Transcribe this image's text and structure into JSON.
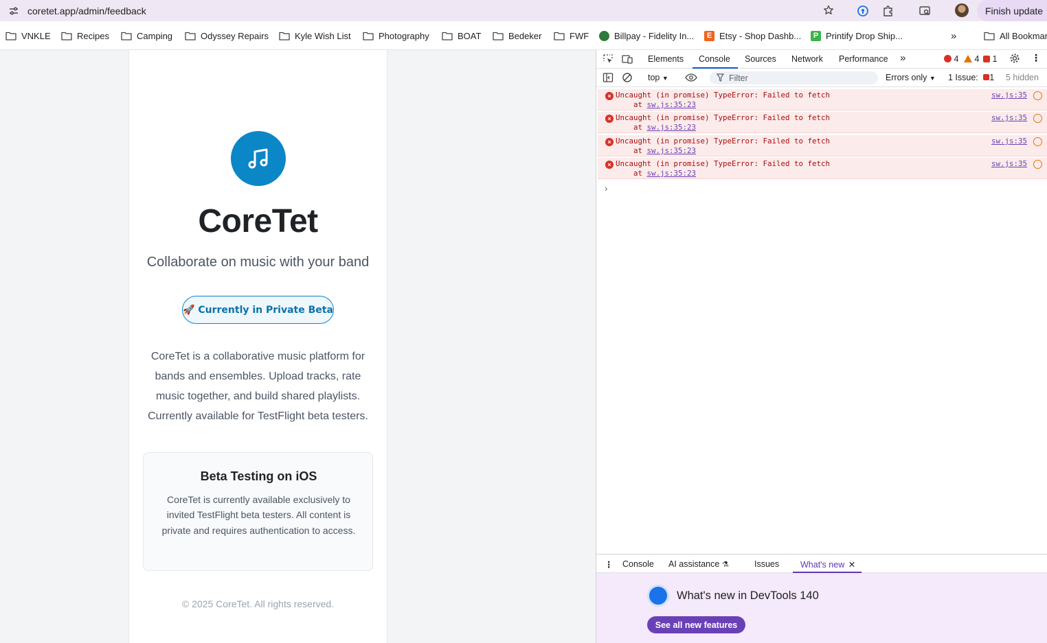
{
  "browser": {
    "url_host": "coretet.app",
    "url_path": "/admin/feedback",
    "finish_update_label": "Finish update",
    "bookmarks": [
      {
        "label": "VNKLE",
        "type": "folder"
      },
      {
        "label": "Recipes",
        "type": "folder"
      },
      {
        "label": "Camping",
        "type": "folder"
      },
      {
        "label": "Odyssey Repairs",
        "type": "folder"
      },
      {
        "label": "Kyle Wish List",
        "type": "folder"
      },
      {
        "label": "Photography",
        "type": "folder"
      },
      {
        "label": "BOAT",
        "type": "folder"
      },
      {
        "label": "Bedeker",
        "type": "folder"
      },
      {
        "label": "FWF",
        "type": "folder"
      },
      {
        "label": "Billpay - Fidelity In...",
        "type": "site"
      },
      {
        "label": "Etsy - Shop Dashb...",
        "type": "site"
      },
      {
        "label": "Printify Drop Ship...",
        "type": "site"
      },
      {
        "label": "All Bookmar",
        "type": "folder"
      }
    ],
    "bookmark_overflow": "»"
  },
  "page": {
    "app_name": "CoreTet",
    "tagline": "Collaborate on music with your band",
    "beta_badge": "🚀 Currently in Private Beta",
    "description": "CoreTet is a collaborative music platform for bands and ensembles. Upload tracks, rate music together, and build shared playlists. Currently available for TestFlight beta testers.",
    "beta_box": {
      "title": "Beta Testing on iOS",
      "text": "CoreTet is currently available exclusively to invited TestFlight beta testers. All content is private and requires authentication to access."
    },
    "copyright": "© 2025 CoreTet. All rights reserved."
  },
  "devtools": {
    "tabs": [
      "Elements",
      "Console",
      "Sources",
      "Network",
      "Performance"
    ],
    "active_tab": "Console",
    "counts": {
      "errors": "4",
      "warnings": "4",
      "issues": "1"
    },
    "toolbar": {
      "context": "top",
      "filter_placeholder": "Filter",
      "level": "Errors only",
      "issues_label": "1 Issue:",
      "issues_count": "1",
      "hidden": "5 hidden"
    },
    "messages": [
      {
        "text": "Uncaught (in promise) TypeError: Failed to fetch",
        "at": "sw.js:35:23",
        "source": "sw.js:35"
      },
      {
        "text": "Uncaught (in promise) TypeError: Failed to fetch",
        "at": "sw.js:35:23",
        "source": "sw.js:35"
      },
      {
        "text": "Uncaught (in promise) TypeError: Failed to fetch",
        "at": "sw.js:35:23",
        "source": "sw.js:35"
      },
      {
        "text": "Uncaught (in promise) TypeError: Failed to fetch",
        "at": "sw.js:35:23",
        "source": "sw.js:35"
      }
    ],
    "drawer": {
      "tabs": [
        "Console",
        "AI assistance",
        "Issues",
        "What's new"
      ],
      "active_tab": "What's new",
      "whats_new_title": "What's new in DevTools 140",
      "see_all_button": "See all new features"
    }
  },
  "colors": {
    "brand": "#0b86c6",
    "devtools_accent": "#0b57d0",
    "error_bg": "#fcebeb",
    "whats_new_bg": "#f4eafb"
  }
}
